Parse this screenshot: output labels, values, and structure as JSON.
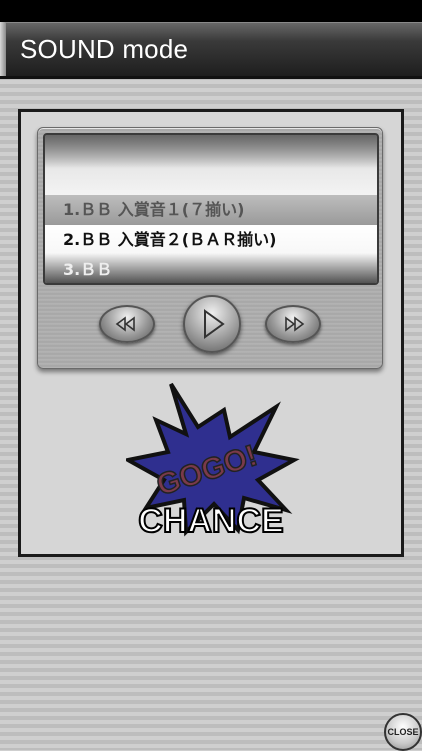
{
  "header": {
    "title": "SOUND mode"
  },
  "tracks": [
    "1.ＢＢ 入賞音１(７揃い)",
    "2.ＢＢ 入賞音２(ＢＡＲ揃い)",
    "3.ＢＢ"
  ],
  "controls": {
    "rewind_icon": "rewind-icon",
    "play_icon": "play-icon",
    "fastforward_icon": "fast-forward-icon"
  },
  "logo": {
    "line1": "GOGO!",
    "line2": "CHANCE"
  },
  "close": {
    "label": "CLOSE"
  },
  "colors": {
    "burst_fill": "#2f2f8f",
    "burst_outline": "#111111",
    "gogo_text": "#7a3a4a"
  }
}
